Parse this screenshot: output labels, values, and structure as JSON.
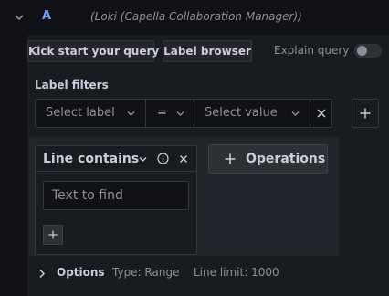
{
  "query": {
    "ref_id": "A",
    "datasource": "(Loki (Capella Collaboration Manager))"
  },
  "toolbar": {
    "kick_start_label": "Kick start your query",
    "label_browser_label": "Label browser",
    "explain_query_label": "Explain query",
    "explain_query_enabled": false
  },
  "label_filters": {
    "title": "Label filters",
    "label_placeholder": "Select label",
    "operator": "=",
    "value_placeholder": "Select value"
  },
  "operation": {
    "title": "Line contains",
    "input_placeholder": "Text to find"
  },
  "operations_button_label": "Operations",
  "options": {
    "title": "Options",
    "type_text": "Type: Range",
    "line_limit_text": "Line limit: 1000"
  },
  "icons": {
    "collapse": "chevron-down-icon",
    "caret": "chevron-down-icon",
    "remove": "close-icon",
    "add": "plus-icon",
    "info": "info-circle-icon",
    "expand": "chevron-right-icon"
  },
  "colors": {
    "accent": "#6e9fff",
    "background": "#111217",
    "panel": "#181b1f",
    "border": "#34363d",
    "text": "#ccccdc",
    "muted_text": "#8e8e9a"
  }
}
